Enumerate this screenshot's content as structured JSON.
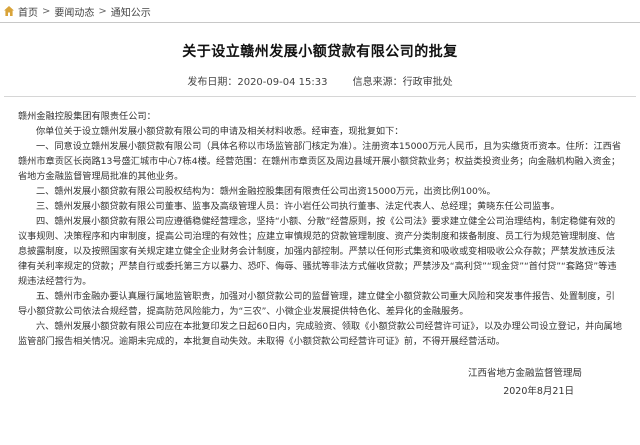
{
  "breadcrumb": {
    "home": "首页",
    "section": "要闻动态",
    "current": "通知公示",
    "separator": ">"
  },
  "article": {
    "title": "关于设立赣州发展小额贷款有限公司的批复",
    "publish_label": "发布日期：2020-09-04 15:33",
    "source_label": "信息来源：行政审批处",
    "salutation": "赣州金融控股集团有限责任公司：",
    "paragraphs": [
      "你单位关于设立赣州发展小额贷款有限公司的申请及相关材料收悉。经审查，现批复如下：",
      "一、同意设立赣州发展小额贷款有限公司（具体名称以市场监管部门核定为准）。注册资本15000万元人民币，且为实缴货币资本。住所：江西省赣州市章贡区长岗路13号盛汇城市中心7栋4楼。经营范围：在赣州市章贡区及周边县域开展小额贷款业务；权益类投资业务；向金融机构融入资金；省地方金融监督管理局批准的其他业务。",
      "二、赣州发展小额贷款有限公司股权结构为：赣州金融控股集团有限责任公司出资15000万元，出资比例100%。",
      "三、赣州发展小额贷款有限公司董事、监事及高级管理人员：许小岩任公司执行董事、法定代表人、总经理；黄晓东任公司监事。",
      "四、赣州发展小额贷款有限公司应遵循稳健经营理念，坚持“小额、分散”经营原则，按《公司法》要求建立健全公司治理结构，制定稳健有效的议事规则、决策程序和内审制度，提高公司治理的有效性；应建立审慎规范的贷款管理制度、资产分类制度和拨备制度、员工行为规范管理制度、信息披露制度，以及按照国家有关规定建立健全企业财务会计制度，加强内部控制。严禁以任何形式集资和吸收或变相吸收公众存款；严禁发放违反法律有关利率规定的贷款；严禁自行或委托第三方以暴力、恐吓、侮辱、骚扰等非法方式催收贷款；严禁涉及“高利贷”“现金贷”“首付贷”“套路贷”等违规违法经营行为。",
      "五、赣州市金融办要认真履行属地监管职责，加强对小额贷款公司的监督管理，建立健全小额贷款公司重大风险和突发事件报告、处置制度，引导小额贷款公司依法合规经营，提高防范风险能力，为“三农”、小微企业发展提供特色化、差异化的金融服务。",
      "六、赣州发展小额贷款有限公司应在本批复印发之日起60日内，完成验资、领取《小额贷款公司经营许可证》，以及办理公司设立登记，并向属地监管部门报告相关情况。逾期未完成的，本批复自动失效。未取得《小额贷款公司经营许可证》前，不得开展经营活动。"
    ],
    "issuer": "江西省地方金融监督管理局",
    "date": "2020年8月21日"
  },
  "icons": {
    "home": "home-icon"
  },
  "colors": {
    "home_icon": "#d9a43a"
  }
}
